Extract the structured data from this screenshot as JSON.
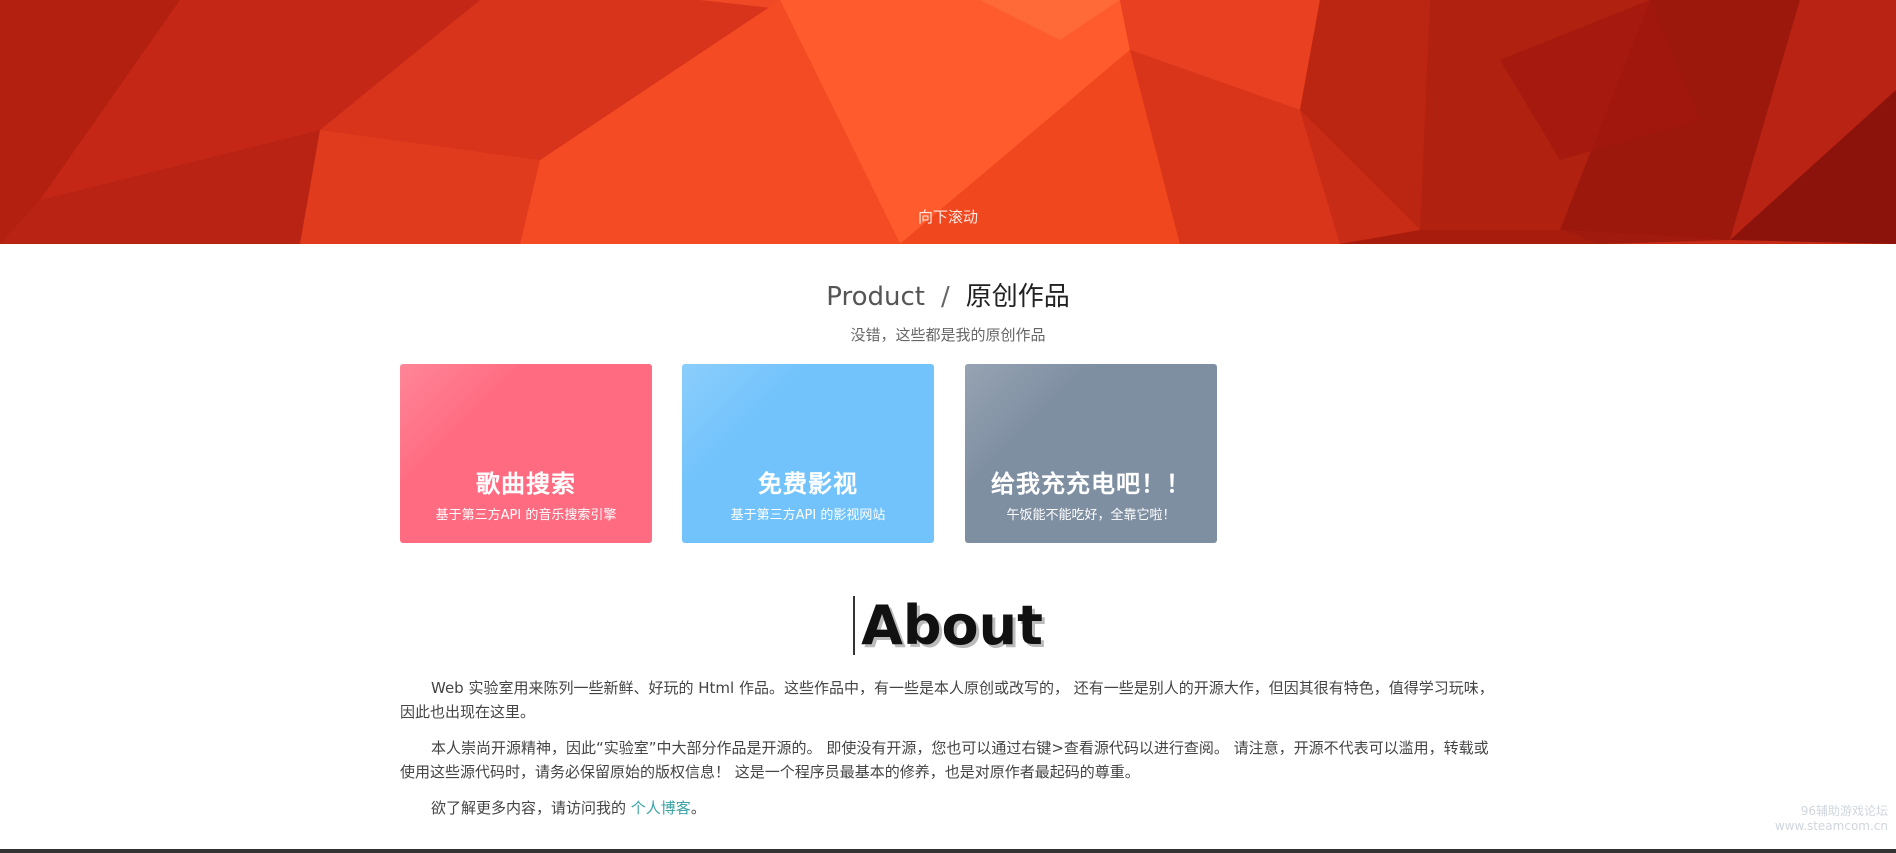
{
  "hero": {
    "scroll_label": "向下滚动",
    "colors": [
      "#c62a17",
      "#e2391d",
      "#ff5a2a",
      "#a3170f",
      "#8c120c",
      "#f04a23"
    ]
  },
  "product": {
    "title_en": "Product",
    "separator": "/",
    "title_cn": "原创作品",
    "subtitle": "没错，这些都是我的原创作品",
    "cards": [
      {
        "title": "歌曲搜索",
        "desc": "基于第三方API 的音乐搜索引擎",
        "color": "#ff6b81"
      },
      {
        "title": "免费影视",
        "desc": "基于第三方API 的影视网站",
        "color": "#72c3fc"
      },
      {
        "title": "给我充充电吧！！",
        "desc": "午饭能不能吃好，全靠它啦！",
        "color": "#7f8fa2"
      }
    ]
  },
  "about": {
    "heading": "About",
    "paragraph_1": "Web 实验室用来陈列一些新鲜、好玩的 Html 作品。这些作品中，有一些是本人原创或改写的， 还有一些是别人的开源大作，但因其很有特色，值得学习玩味，因此也出现在这里。",
    "paragraph_2": "本人崇尚开源精神，因此“实验室”中大部分作品是开源的。 即使没有开源，您也可以通过右键>查看源代码以进行查阅。 请注意，开源不代表可以滥用，转载或使用这些源代码时，请务必保留原始的版权信息！ 这是一个程序员最基本的修养，也是对原作者最起码的尊重。",
    "paragraph_3_prefix": "欲了解更多内容，请访问我的",
    "blog_link": "个人博客",
    "paragraph_3_suffix": "。"
  },
  "watermark": {
    "line_1": "96辅助游戏论坛",
    "line_2": "www.steamcom.cn"
  }
}
